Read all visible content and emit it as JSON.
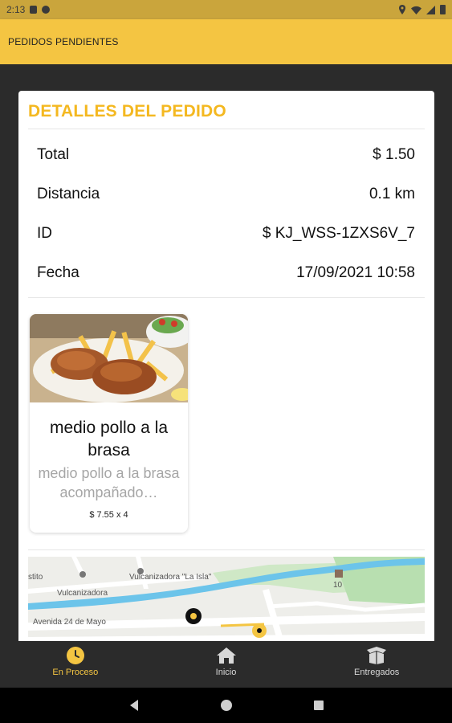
{
  "status_bar": {
    "time": "2:13",
    "icons_left": [
      "sim-icon",
      "vpn-icon"
    ],
    "icons_right": [
      "location-icon",
      "wifi-icon",
      "signal-icon",
      "battery-icon"
    ]
  },
  "app_bar": {
    "title": "PEDIDOS PENDIENTES"
  },
  "order": {
    "title": "DETALLES DEL PEDIDO",
    "rows": [
      {
        "label": "Total",
        "value": "$ 1.50"
      },
      {
        "label": "Distancia",
        "value": "0.1 km"
      },
      {
        "label": "ID",
        "value": "$ KJ_WSS-1ZXS6V_7"
      },
      {
        "label": "Fecha",
        "value": "17/09/2021 10:58"
      }
    ]
  },
  "product": {
    "name": "medio pollo a la brasa",
    "description": "medio pollo a la brasa acompañado…",
    "price": "$ 7.55 x 4",
    "image_icon": "roast-chicken-photo"
  },
  "map": {
    "labels": [
      "stito",
      "Vulcanizadora \"La Isla\"",
      "Vulcanizadora",
      "Avenida 24 de Mayo",
      "10"
    ]
  },
  "bottom_nav": [
    {
      "label": "En Proceso",
      "icon": "clock-icon",
      "active": true
    },
    {
      "label": "Inicio",
      "icon": "home-icon",
      "active": false
    },
    {
      "label": "Entregados",
      "icon": "box-icon",
      "active": false
    }
  ],
  "colors": {
    "accent": "#f4c542",
    "title_yellow": "#f4b820",
    "dark_bg": "#2b2b2b"
  }
}
